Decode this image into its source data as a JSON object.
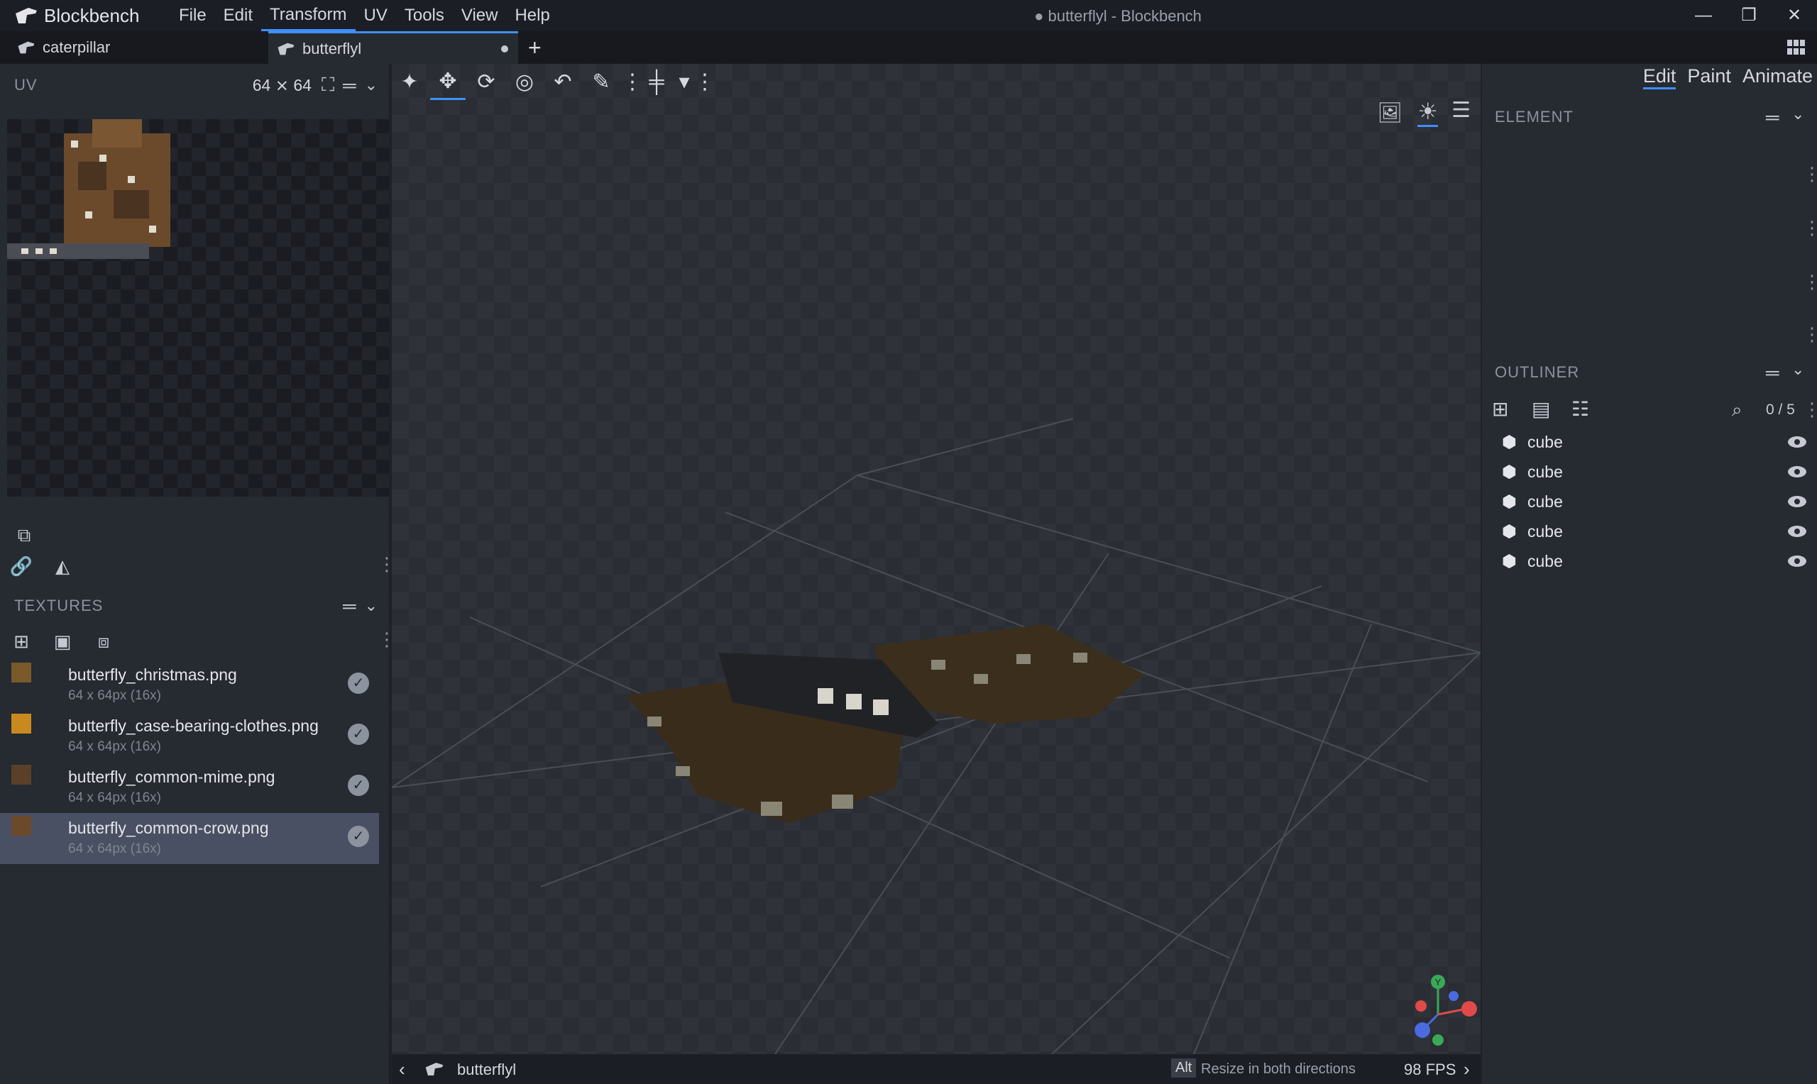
{
  "app": {
    "name": "Blockbench",
    "window_title": "● butterflyl - Blockbench"
  },
  "menu": [
    "File",
    "Edit",
    "Transform",
    "UV",
    "Tools",
    "View",
    "Help"
  ],
  "window_controls": [
    "—",
    "❐",
    "✕"
  ],
  "tabs": [
    {
      "label": "caterpillar"
    },
    {
      "label": "butterflyl"
    }
  ],
  "add_tab": "+",
  "uv": {
    "title": "UV",
    "size": "64 ⨯ 64"
  },
  "textures": {
    "title": "TEXTURES",
    "items": [
      {
        "name": "butterfly_christmas.png",
        "size": "64 x 64px (16x)",
        "color": "#7a5a2a"
      },
      {
        "name": "butterfly_case-bearing-clothes.png",
        "size": "64 x 64px (16x)",
        "color": "#c88a1e"
      },
      {
        "name": "butterfly_common-mime.png",
        "size": "64 x 64px (16x)",
        "color": "#5a4028"
      },
      {
        "name": "butterfly_common-crow.png",
        "size": "64 x 64px (16x)",
        "color": "#6b4a2c"
      }
    ]
  },
  "modes": [
    "Edit",
    "Paint",
    "Animate"
  ],
  "element": {
    "title": "ELEMENT"
  },
  "outliner": {
    "title": "OUTLINER",
    "count": "0 / 5",
    "items": [
      "cube",
      "cube",
      "cube",
      "cube",
      "cube"
    ]
  },
  "status": {
    "model": "butterflyl",
    "key": "Alt",
    "hint": "Resize in both directions",
    "fps": "98 FPS"
  },
  "gizmo": {
    "y": "Y",
    "x": "X",
    "z": "Z"
  },
  "colors": {
    "accent": "#3e90ff",
    "bg": "#262a31"
  }
}
